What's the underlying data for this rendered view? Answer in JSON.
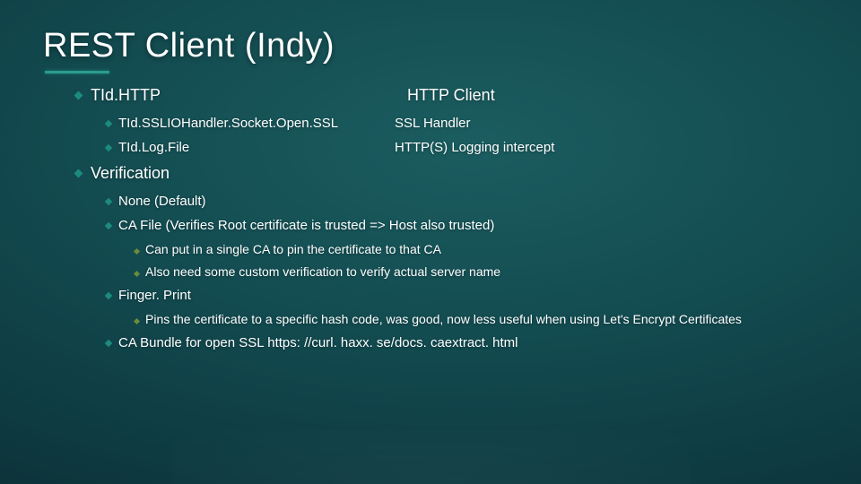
{
  "title": "REST Client (Indy)",
  "items": [
    {
      "label": "TId.HTTP",
      "desc": "HTTP Client",
      "children": [
        {
          "label": "TId.SSLIOHandler.Socket.Open.SSL",
          "desc": "SSL Handler"
        },
        {
          "label": "TId.Log.File",
          "desc": "HTTP(S) Logging intercept"
        }
      ]
    },
    {
      "label": "Verification",
      "children": [
        {
          "label": "None (Default)"
        },
        {
          "label": "CA File (Verifies Root certificate is trusted => Host also trusted)",
          "children": [
            {
              "label": "Can put in a single CA to pin the certificate to that CA"
            },
            {
              "label": "Also need some custom verification to verify actual server name"
            }
          ]
        },
        {
          "label": "Finger. Print",
          "children": [
            {
              "label": "Pins the certificate to a specific hash code, was good, now less useful when using Let's Encrypt Certificates"
            }
          ]
        },
        {
          "label": "CA Bundle for open SSL https: //curl. haxx. se/docs. caextract. html"
        }
      ]
    }
  ]
}
